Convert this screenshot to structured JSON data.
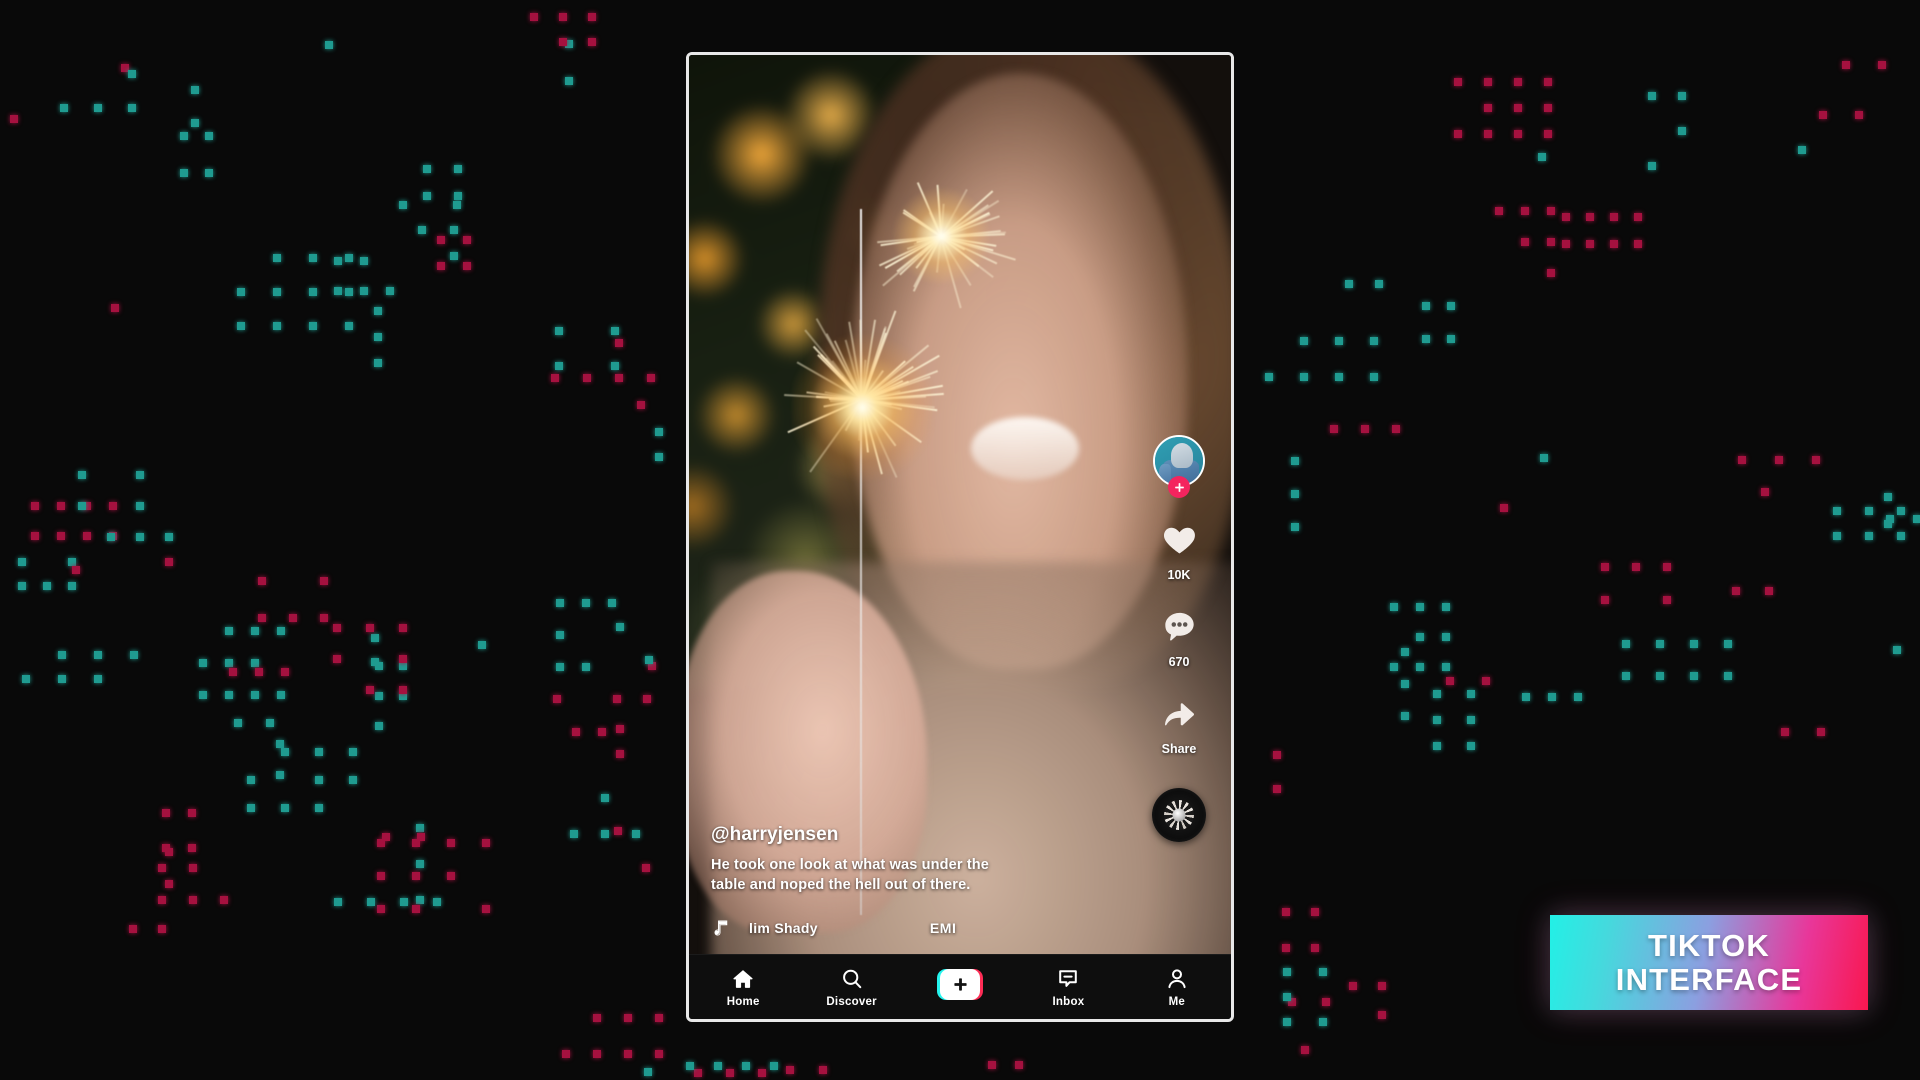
{
  "background": {
    "color": "#090909",
    "dot_colors": {
      "teal": "#1f9b90",
      "crimson": "#a5113f"
    }
  },
  "phone": {
    "frame_color": "#e8e8e8"
  },
  "video": {
    "description": "blurred portrait of a smiling woman holding a lit sparkler with bokeh christmas lights"
  },
  "post": {
    "username": "@harryjensen",
    "caption": "He took one look at what was under the table and noped the hell out of there.",
    "music": {
      "icon": "music-note-icon",
      "title": "lim Shady",
      "label": "EMI"
    }
  },
  "actions": {
    "avatar": {
      "icon": "avatar",
      "follow_badge": "plus-icon"
    },
    "like": {
      "icon": "heart-icon",
      "count": "10K"
    },
    "comment": {
      "icon": "comment-icon",
      "count": "670"
    },
    "share": {
      "icon": "share-arrow-icon",
      "label": "Share"
    },
    "sound_disc": {
      "icon": "vinyl-record-icon"
    }
  },
  "nav": {
    "items": [
      {
        "icon": "home-icon",
        "label": "Home"
      },
      {
        "icon": "search-icon",
        "label": "Discover"
      },
      {
        "icon": "plus-icon",
        "label": ""
      },
      {
        "icon": "inbox-icon",
        "label": "Inbox"
      },
      {
        "icon": "person-icon",
        "label": "Me"
      }
    ]
  },
  "badge": {
    "line1": "TIKTOK",
    "line2": "INTERFACE",
    "gradient_from": "#22f0e6",
    "gradient_to": "#f9174f"
  }
}
